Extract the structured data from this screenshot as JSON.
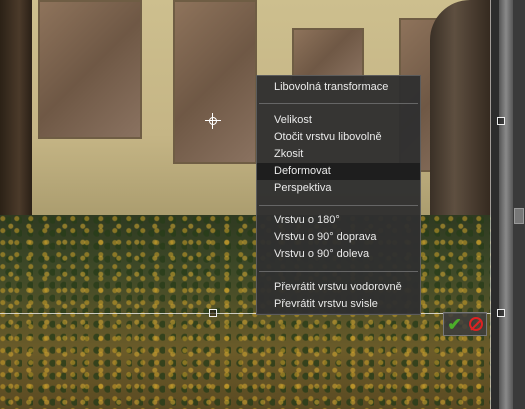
{
  "menu": {
    "items": {
      "free_transform": "Libovolná transformace",
      "size": "Velikost",
      "rotate_free": "Otočit vrstvu libovolně",
      "skew": "Zkosit",
      "distort": "Deformovat",
      "perspective": "Perspektiva",
      "rotate_180": "Vrstvu o 180°",
      "rotate_90_cw": "Vrstvu o 90° doprava",
      "rotate_90_ccw": "Vrstvu o 90° doleva",
      "flip_horizontal": "Převrátit vrstvu vodorovně",
      "flip_vertical": "Převrátit vrstvu svisle"
    },
    "active_item": "distort"
  },
  "actions": {
    "confirm_icon": "checkmark-icon",
    "cancel_icon": "cancel-icon",
    "confirm_color": "#4caf2a",
    "cancel_color": "#dd2222"
  },
  "colors": {
    "menu_bg": "#303030",
    "menu_highlight": "#1e1e1e",
    "menu_text": "#eaeaea"
  }
}
